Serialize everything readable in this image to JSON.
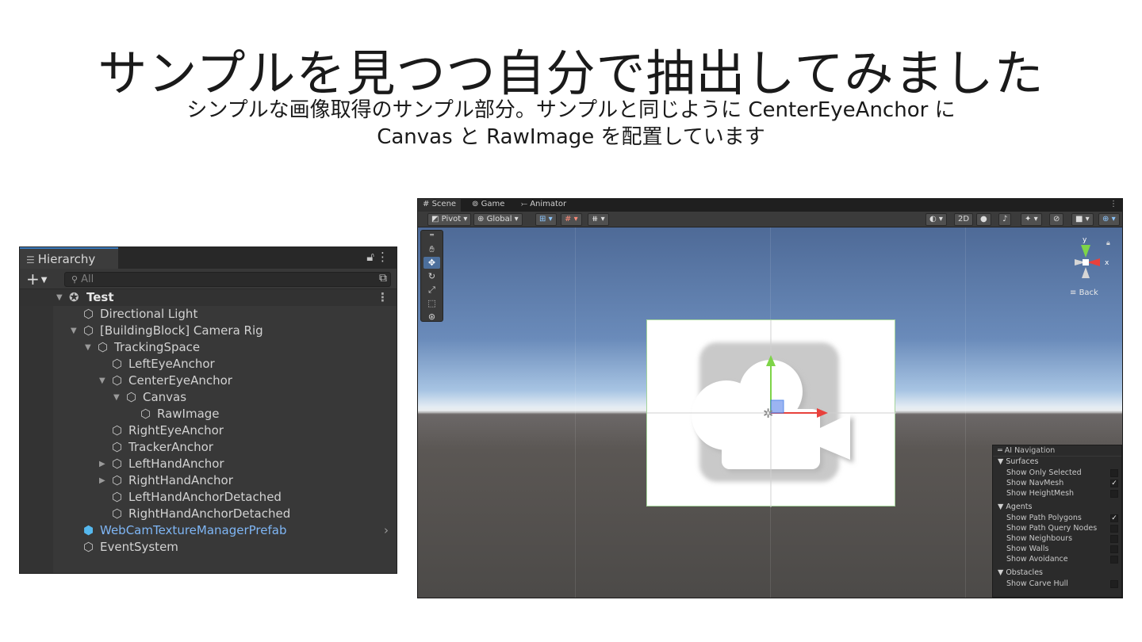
{
  "slide": {
    "title": "サンプルを見つつ自分で抽出してみました",
    "subtitle_line1": "シンプルな画像取得のサンプル部分。サンプルと同じように CenterEyeAnchor に",
    "subtitle_line2": "Canvas と RawImage を配置しています"
  },
  "hierarchy": {
    "tab_label": "Hierarchy",
    "search_placeholder": "All",
    "scene_name": "Test",
    "items": [
      {
        "label": "Directional Light"
      },
      {
        "label": "[BuildingBlock] Camera Rig"
      },
      {
        "label": "TrackingSpace"
      },
      {
        "label": "LeftEyeAnchor"
      },
      {
        "label": "CenterEyeAnchor"
      },
      {
        "label": "Canvas"
      },
      {
        "label": "RawImage"
      },
      {
        "label": "RightEyeAnchor"
      },
      {
        "label": "TrackerAnchor"
      },
      {
        "label": "LeftHandAnchor"
      },
      {
        "label": "RightHandAnchor"
      },
      {
        "label": "LeftHandAnchorDetached"
      },
      {
        "label": "RightHandAnchorDetached"
      },
      {
        "label": "WebCamTextureManagerPrefab"
      },
      {
        "label": "EventSystem"
      }
    ]
  },
  "scene_view": {
    "tabs": [
      {
        "label": "Scene",
        "icon": "grid-icon"
      },
      {
        "label": "Game",
        "icon": "gamepad-icon"
      },
      {
        "label": "Animator",
        "icon": "animator-icon"
      }
    ],
    "toolbar": {
      "pivot": "Pivot",
      "global": "Global",
      "mode_2d": "2D"
    },
    "orientation_axes": {
      "y": "y",
      "x": "x"
    },
    "view_label": "Back",
    "ai_navigation": {
      "title": "AI Navigation",
      "sections": [
        {
          "name": "Surfaces",
          "options": [
            {
              "label": "Show Only Selected",
              "checked": false
            },
            {
              "label": "Show NavMesh",
              "checked": true
            },
            {
              "label": "Show HeightMesh",
              "checked": false
            }
          ]
        },
        {
          "name": "Agents",
          "options": [
            {
              "label": "Show Path Polygons",
              "checked": true
            },
            {
              "label": "Show Path Query Nodes",
              "checked": false
            },
            {
              "label": "Show Neighbours",
              "checked": false
            },
            {
              "label": "Show Walls",
              "checked": false
            },
            {
              "label": "Show Avoidance",
              "checked": false
            }
          ]
        },
        {
          "name": "Obstacles",
          "options": [
            {
              "label": "Show Carve Hull",
              "checked": false
            }
          ]
        }
      ]
    },
    "colors": {
      "x_axis": "#e8413c",
      "y_axis": "#7ed448",
      "z_axis": "#3b78e8",
      "selection_blue": "#3a79bb"
    }
  }
}
